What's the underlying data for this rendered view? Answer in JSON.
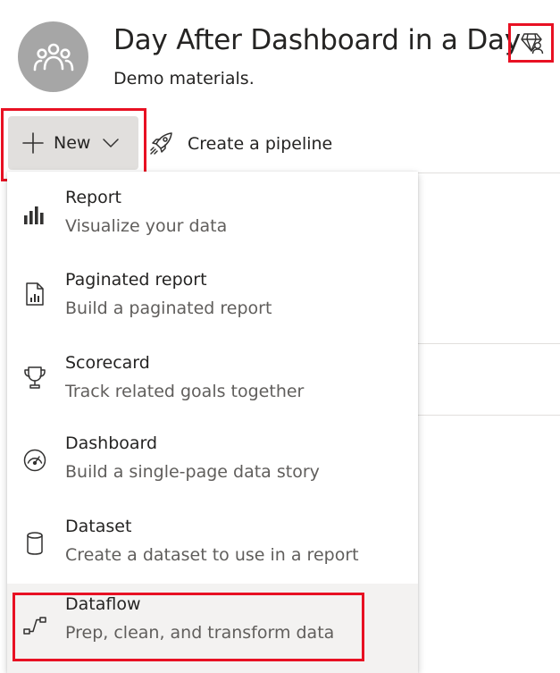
{
  "workspace": {
    "title": "Day After Dashboard in a Day",
    "description": "Demo materials.",
    "avatar_icon": "group-icon",
    "premium_icon": "premium-diamond-user-icon"
  },
  "toolbar": {
    "new_label": "New",
    "pipeline_label": "Create a pipeline"
  },
  "menu": {
    "items": [
      {
        "title": "Report",
        "subtitle": "Visualize your data",
        "icon": "bar-chart-icon"
      },
      {
        "title": "Paginated report",
        "subtitle": "Build a paginated report",
        "icon": "paginated-report-icon"
      },
      {
        "title": "Scorecard",
        "subtitle": "Track related goals together",
        "icon": "trophy-icon"
      },
      {
        "title": "Dashboard",
        "subtitle": "Build a single-page data story",
        "icon": "gauge-icon"
      },
      {
        "title": "Dataset",
        "subtitle": "Create a dataset to use in a report",
        "icon": "cylinder-icon"
      },
      {
        "title": "Dataflow",
        "subtitle": "Prep, clean, and transform data",
        "icon": "dataflow-icon"
      }
    ]
  },
  "colors": {
    "highlight": "#e81123",
    "button_bg": "#e1dfdd",
    "selected_bg": "#f3f2f1",
    "avatar_bg": "#a6a6a6"
  }
}
